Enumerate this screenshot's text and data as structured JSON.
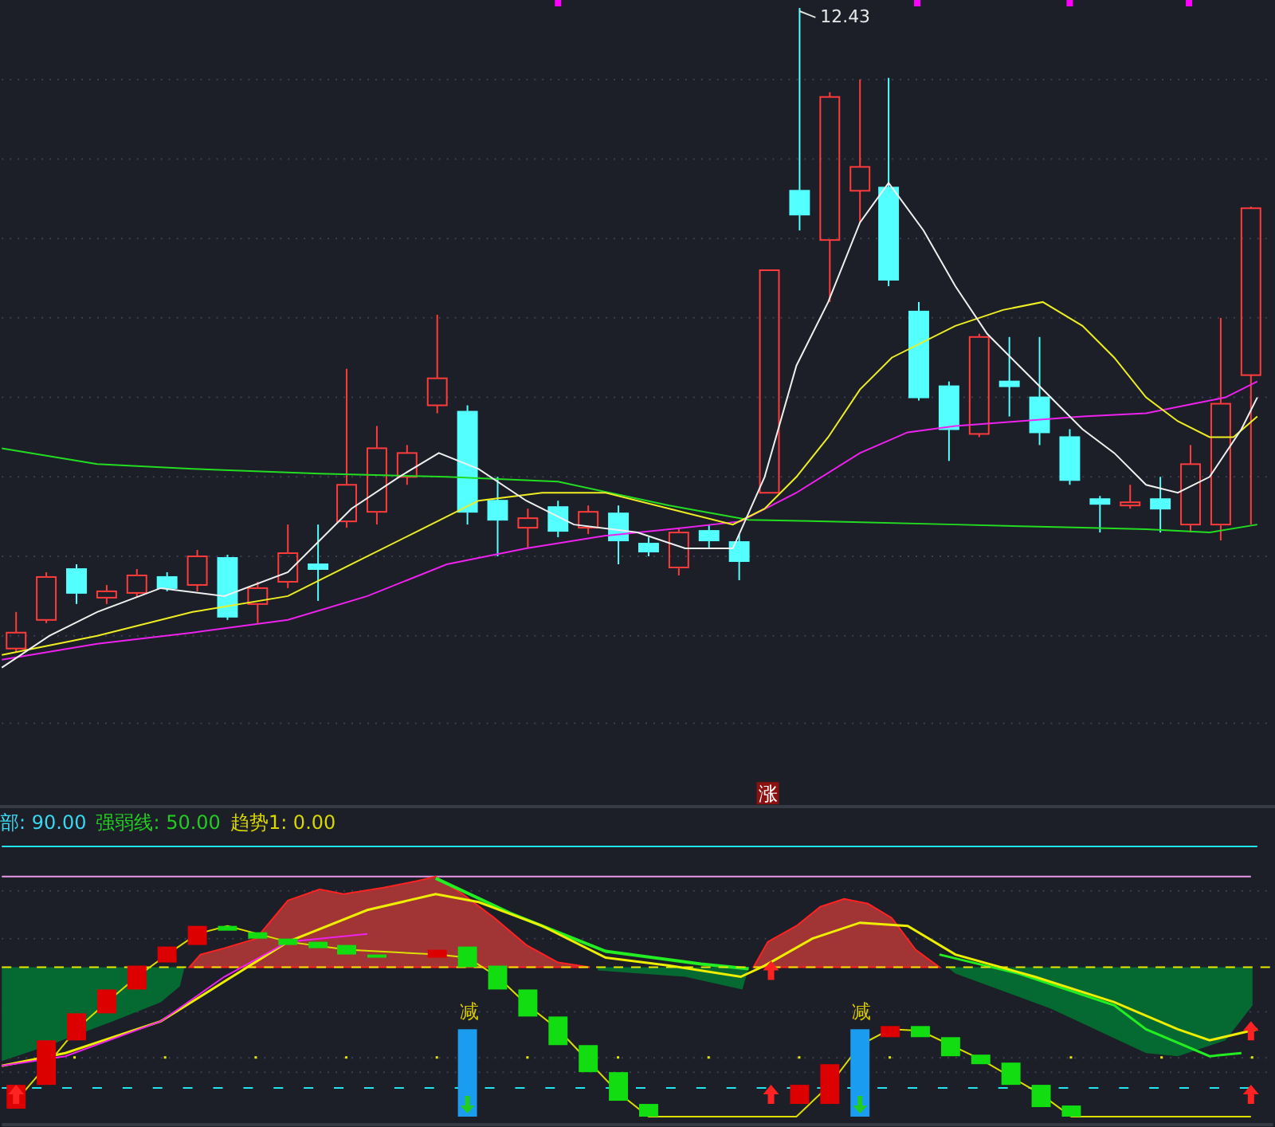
{
  "main_chart": {
    "high_label": "12.43",
    "signal_tag": "涨"
  },
  "indicator": {
    "legend": [
      {
        "label": "部: 90.00",
        "color": "#3ad8f0"
      },
      {
        "label": "强弱线: 50.00",
        "color": "#22cc22"
      },
      {
        "label": "趋势1: 0.00",
        "color": "#d8d800"
      }
    ],
    "signals": [
      {
        "label": "减"
      },
      {
        "label": "减"
      }
    ]
  }
}
